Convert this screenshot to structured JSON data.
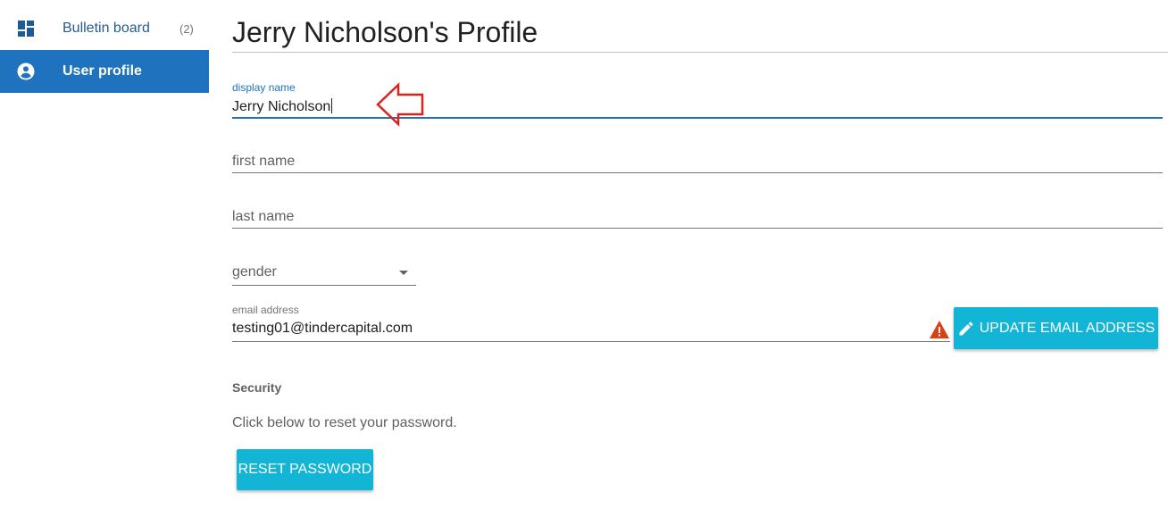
{
  "sidebar": {
    "items": [
      {
        "label": "Bulletin board",
        "count": "(2)",
        "icon": "dashboard-icon"
      },
      {
        "label": "User profile",
        "icon": "account-circle-icon",
        "active": true
      }
    ]
  },
  "page": {
    "title": "Jerry Nicholson's Profile"
  },
  "form": {
    "display_name": {
      "label": "display name",
      "value": "Jerry Nicholson"
    },
    "first_name": {
      "placeholder": "first name"
    },
    "last_name": {
      "placeholder": "last name"
    },
    "gender": {
      "placeholder": "gender"
    },
    "email": {
      "label": "email address",
      "value": "testing01@tindercapital.com",
      "status_icon": "warning-icon"
    },
    "update_email_label": "UPDATE EMAIL ADDRESS"
  },
  "security": {
    "heading": "Security",
    "help": "Click below to reset your password.",
    "reset_label": "RESET PASSWORD"
  },
  "colors": {
    "accent": "#1e72be",
    "button": "#12b5d6",
    "warning": "#d84315",
    "annotation": "#e0201c"
  }
}
